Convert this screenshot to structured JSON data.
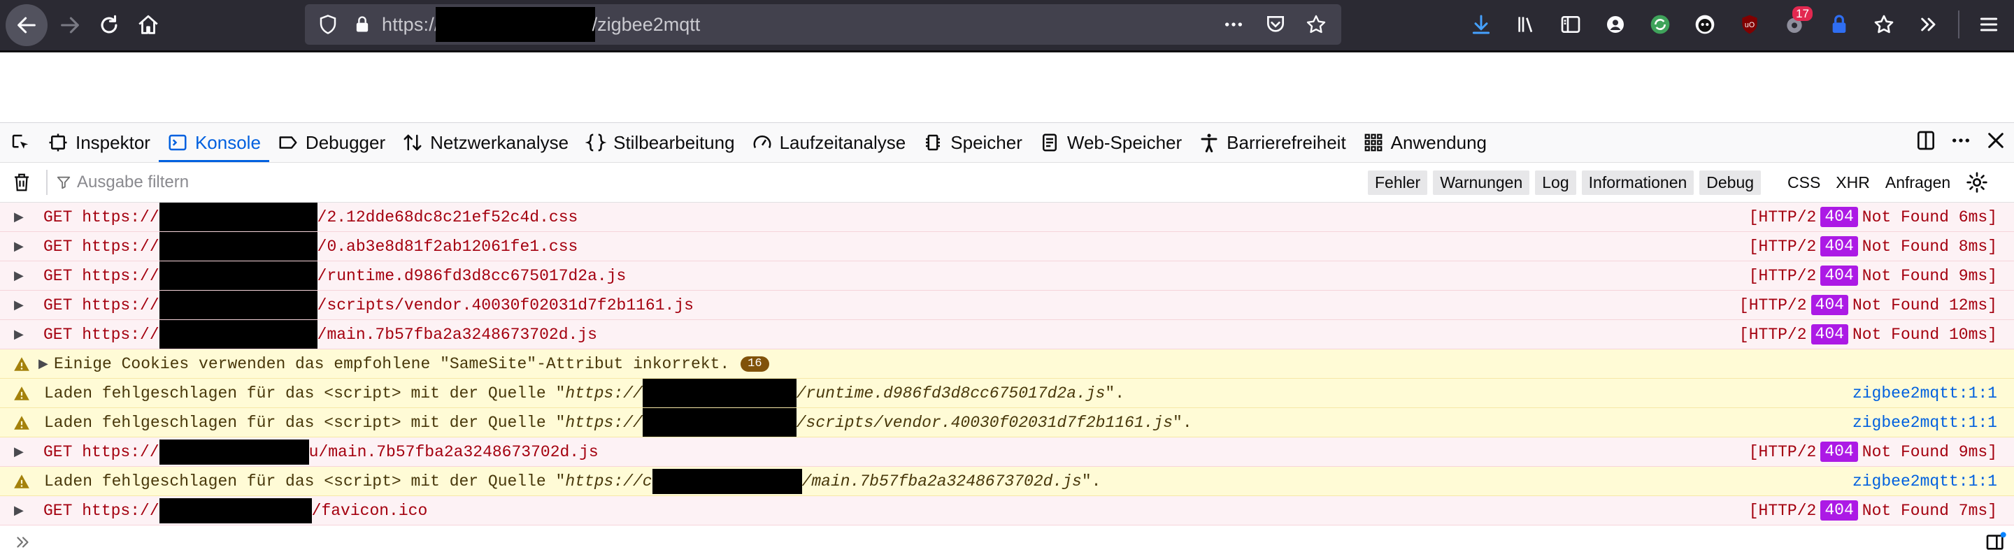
{
  "browser": {
    "url_prefix": "https://",
    "url_suffix": "/zigbee2mqtt",
    "badge_count": "17"
  },
  "devtools": {
    "tabs": [
      {
        "label": "Inspektor"
      },
      {
        "label": "Konsole"
      },
      {
        "label": "Debugger"
      },
      {
        "label": "Netzwerkanalyse"
      },
      {
        "label": "Stilbearbeitung"
      },
      {
        "label": "Laufzeitanalyse"
      },
      {
        "label": "Speicher"
      },
      {
        "label": "Web-Speicher"
      },
      {
        "label": "Barrierefreiheit"
      },
      {
        "label": "Anwendung"
      }
    ],
    "filter_placeholder": "Ausgabe filtern",
    "levels": [
      "Fehler",
      "Warnungen",
      "Log",
      "Informationen",
      "Debug"
    ],
    "types": [
      "CSS",
      "XHR",
      "Anfragen"
    ]
  },
  "log": {
    "rows": [
      {
        "prefix": "GET https://",
        "suffix": "/2.12dde68dc8c21ef52c4d.css",
        "http": "[HTTP/2",
        "code": "404",
        "status": "Not Found 6ms]"
      },
      {
        "prefix": "GET https://",
        "suffix": "/0.ab3e8d81f2ab12061fe1.css",
        "http": "[HTTP/2",
        "code": "404",
        "status": "Not Found 8ms]"
      },
      {
        "prefix": "GET https://",
        "suffix": "/runtime.d986fd3d8cc675017d2a.js",
        "http": "[HTTP/2",
        "code": "404",
        "status": "Not Found 9ms]"
      },
      {
        "prefix": "GET https://",
        "suffix": "/scripts/vendor.40030f02031d7f2b1161.js",
        "http": "[HTTP/2",
        "code": "404",
        "status": "Not Found 12ms]"
      },
      {
        "prefix": "GET https://",
        "suffix": "/main.7b57fba2a3248673702d.js",
        "http": "[HTTP/2",
        "code": "404",
        "status": "Not Found 10ms]"
      },
      {
        "text": "Einige Cookies verwenden das empfohlene \"SameSite\"-Attribut inkorrekt.",
        "count": "16"
      },
      {
        "text": "Laden fehlgeschlagen für das <script> mit der Quelle \"",
        "url_prefix": "https://",
        "url_suffix": "/runtime.d986fd3d8cc675017d2a.js",
        "close": "\".",
        "source": "zigbee2mqtt:1:1"
      },
      {
        "text": "Laden fehlgeschlagen für das <script> mit der Quelle \"",
        "url_prefix": "https://",
        "url_suffix": "/scripts/vendor.40030f02031d7f2b1161.js",
        "close": "\".",
        "source": "zigbee2mqtt:1:1"
      },
      {
        "prefix": "GET https://",
        "suffix": "u/main.7b57fba2a3248673702d.js",
        "http": "[HTTP/2",
        "code": "404",
        "status": "Not Found 9ms]"
      },
      {
        "text": "Laden fehlgeschlagen für das <script> mit der Quelle \"",
        "url_prefix": "https://c",
        "url_suffix": "/main.7b57fba2a3248673702d.js",
        "close": "\".",
        "source": "zigbee2mqtt:1:1"
      },
      {
        "prefix": "GET https://",
        "suffix": "/favicon.ico",
        "http": "[HTTP/2",
        "code": "404",
        "status": "Not Found 7ms]"
      }
    ]
  }
}
